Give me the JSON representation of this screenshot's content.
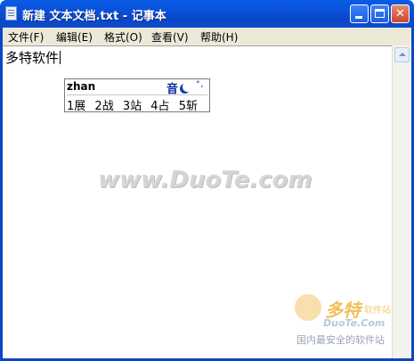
{
  "window": {
    "title": "新建 文本文档.txt - 记事本",
    "app_icon": "notepad-icon",
    "controls": {
      "minimize_icon": "minimize-icon",
      "maximize_icon": "maximize-icon",
      "close_label": "✕"
    }
  },
  "menu": {
    "items": [
      {
        "label": "文件(F)"
      },
      {
        "label": "编辑(E)"
      },
      {
        "label": "格式(O)"
      },
      {
        "label": "查看(V)"
      },
      {
        "label": "帮助(H)"
      }
    ]
  },
  "editor": {
    "text": "多特软件"
  },
  "ime": {
    "pinyin": "zhan",
    "mode_label": "音",
    "status_icon": "moon-icon",
    "punct_label": "°,",
    "candidates": [
      "1展",
      "2战",
      "3站",
      "4占",
      "5斩"
    ]
  },
  "watermark": {
    "center": "www.DuoTe.com",
    "brand": "多特",
    "brand_sub": "软件站",
    "domain": "DuoTe.Com",
    "slogan": "国内最安全的软件站"
  },
  "colors": {
    "titlebar": "#0a4fd6",
    "menubar": "#ece9d8",
    "close_button": "#c9462a"
  }
}
